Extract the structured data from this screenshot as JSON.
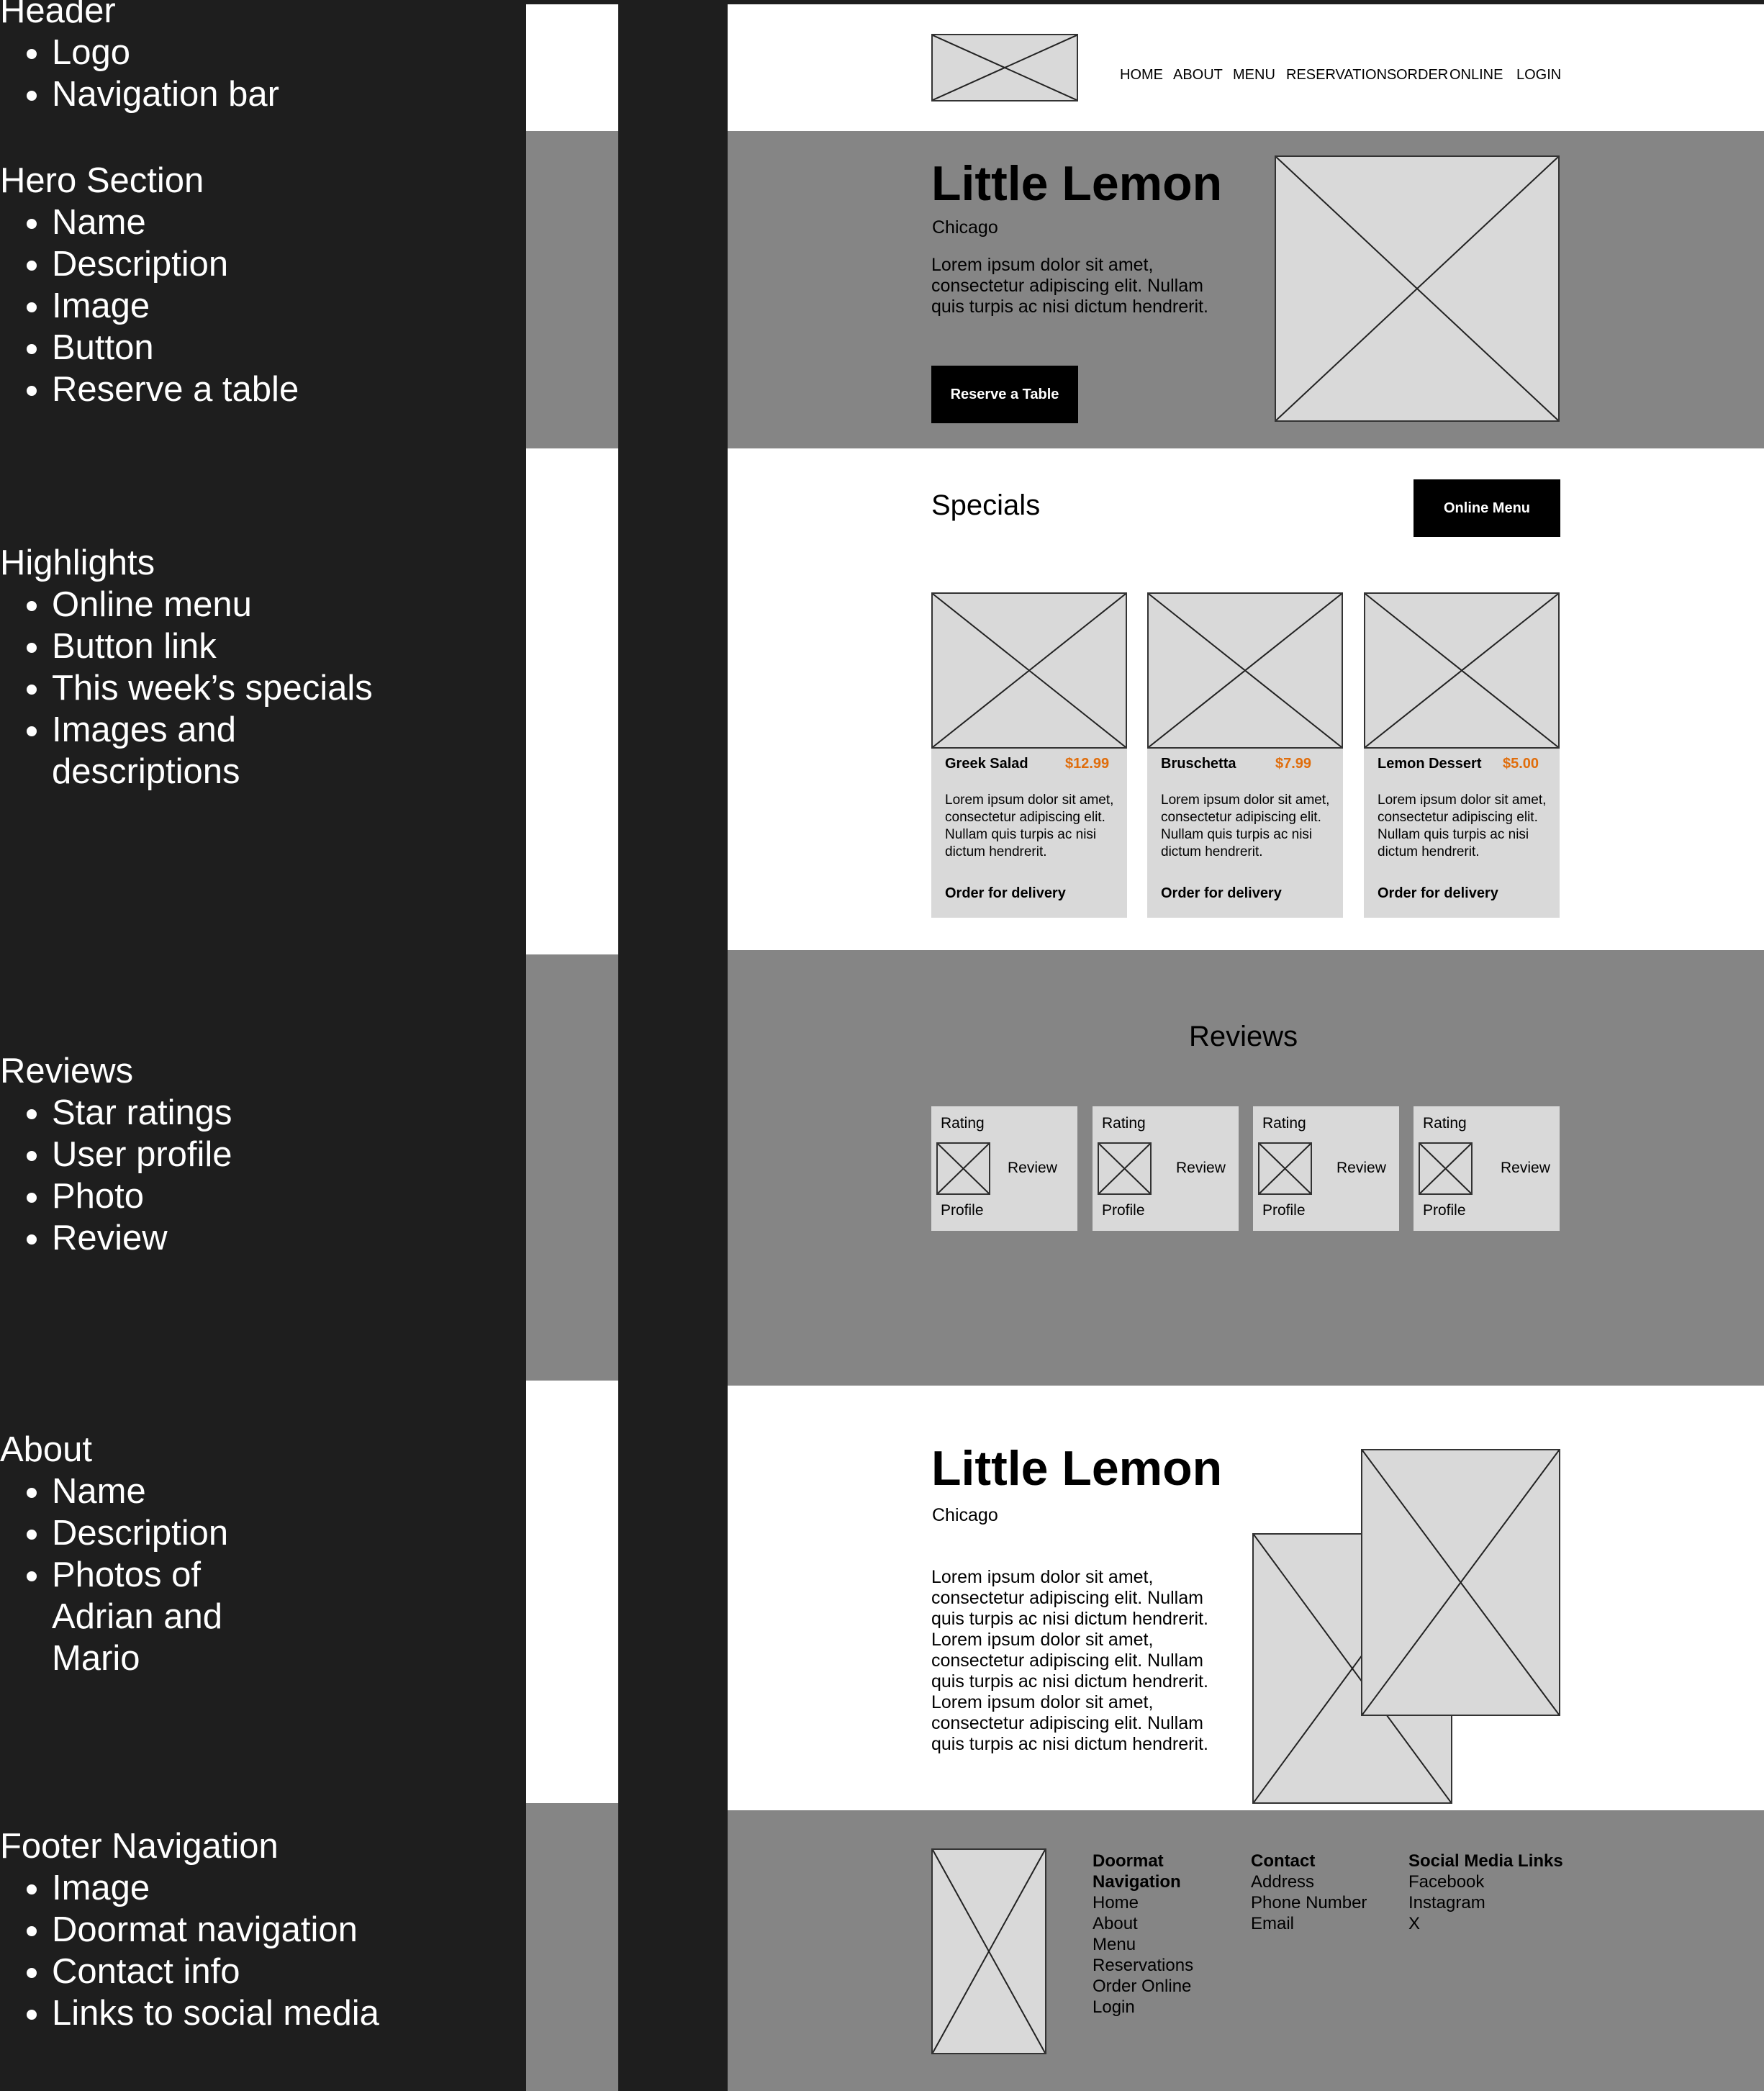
{
  "annotations": [
    {
      "title": "Header",
      "items": [
        "Logo",
        "Navigation bar"
      ]
    },
    {
      "title": "Hero Section",
      "items": [
        "Name",
        "Description",
        "Image",
        "Button",
        "Reserve a table"
      ]
    },
    {
      "title": "Highlights",
      "items": [
        "Online menu",
        "Button link",
        "This week’s specials",
        "Images and descriptions"
      ]
    },
    {
      "title": "Reviews",
      "items": [
        "Star ratings",
        "User profile",
        "Photo",
        "Review"
      ]
    },
    {
      "title": "About",
      "items": [
        "Name",
        "Description",
        "Photos of Adrian and Mario"
      ]
    },
    {
      "title": "Footer Navigation",
      "items": [
        "Image",
        "Doormat navigation",
        "Contact info",
        "Links to social media"
      ]
    }
  ],
  "nav": [
    "HOME",
    "ABOUT",
    "MENU",
    "RESERVATIONS",
    "ORDER",
    "ONLINE",
    "LOGIN"
  ],
  "hero": {
    "name": "Little Lemon",
    "city": "Chicago",
    "description": "Lorem ipsum dolor sit amet, consectetur adipiscing elit. Nullam quis turpis ac nisi dictum hendrerit.",
    "button": "Reserve a Table"
  },
  "specials": {
    "title": "Specials",
    "button": "Online Menu",
    "cards": [
      {
        "name": "Greek Salad",
        "price": "$12.99",
        "description": "Lorem ipsum dolor sit amet, consectetur adipiscing elit. Nullam quis turpis ac nisi dictum hendrerit.",
        "order": "Order for delivery"
      },
      {
        "name": "Bruschetta",
        "price": "$7.99",
        "description": "Lorem ipsum dolor sit amet, consectetur adipiscing elit. Nullam quis turpis ac nisi dictum hendrerit.",
        "order": "Order for delivery"
      },
      {
        "name": "Lemon Dessert",
        "price": "$5.00",
        "description": "Lorem ipsum dolor sit amet, consectetur adipiscing elit. Nullam quis turpis ac nisi dictum hendrerit.",
        "order": "Order for delivery"
      }
    ]
  },
  "reviews": {
    "title": "Reviews",
    "cards": [
      {
        "rating": "Rating",
        "review": "Review",
        "profile": "Profile"
      },
      {
        "rating": "Rating",
        "review": "Review",
        "profile": "Profile"
      },
      {
        "rating": "Rating",
        "review": "Review",
        "profile": "Profile"
      },
      {
        "rating": "Rating",
        "review": "Review",
        "profile": "Profile"
      }
    ]
  },
  "about": {
    "name": "Little Lemon",
    "city": "Chicago",
    "description": "Lorem ipsum dolor sit amet, consectetur adipiscing elit. Nullam quis turpis ac nisi dictum hendrerit. Lorem ipsum dolor sit amet, consectetur adipiscing elit. Nullam quis turpis ac nisi dictum hendrerit. Lorem ipsum dolor sit amet, consectetur adipiscing elit. Nullam quis turpis ac nisi dictum hendrerit."
  },
  "footer": {
    "doormat": {
      "heading": "Doormat Navigation",
      "links": [
        "Home",
        "About",
        "Menu",
        "Reservations",
        "Order Online",
        "Login"
      ]
    },
    "contact": {
      "heading": "Contact",
      "links": [
        "Address",
        "Phone Number",
        "Email"
      ]
    },
    "social": {
      "heading": "Social Media Links",
      "links": [
        "Facebook",
        "Instagram",
        "X"
      ]
    }
  },
  "colors": {
    "annotation_bg": "#1e1e1e",
    "band_gray": "#858585",
    "placeholder": "#d9d9d9",
    "price_accent": "#e06d0b",
    "button_bg": "#000000"
  }
}
